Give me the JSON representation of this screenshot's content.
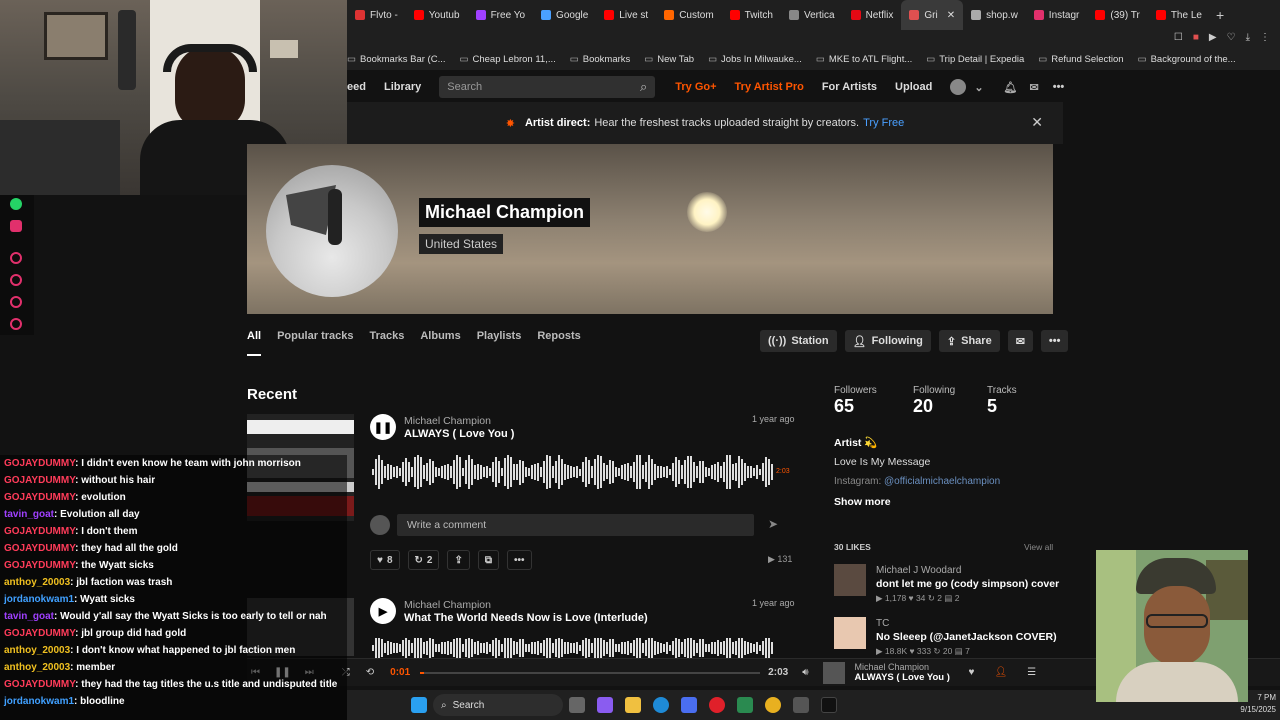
{
  "browser": {
    "tabs": [
      {
        "label": "Flvto -",
        "color": "#d33"
      },
      {
        "label": "Youtub",
        "color": "#f00"
      },
      {
        "label": "Free Yo",
        "color": "#a040ff"
      },
      {
        "label": "Google",
        "color": "#4aa0ff"
      },
      {
        "label": "Live st",
        "color": "#f00"
      },
      {
        "label": "Custom",
        "color": "#f60"
      },
      {
        "label": "Twitch",
        "color": "#f00"
      },
      {
        "label": "Vertica",
        "color": "#888"
      },
      {
        "label": "Netflix",
        "color": "#e50914"
      },
      {
        "label": "Gri",
        "color": "#e05050",
        "active": true
      },
      {
        "label": "shop.w",
        "color": "#aaa"
      },
      {
        "label": "Instagr",
        "color": "#e1306c"
      },
      {
        "label": "(39) Tr",
        "color": "#f00"
      },
      {
        "label": "The Le",
        "color": "#f00"
      }
    ],
    "bookmarks": [
      "Bookmarks Bar (C...",
      "Cheap Lebron 11,...",
      "Bookmarks",
      "New Tab",
      "Jobs In Milwauke...",
      "MKE to ATL Flight...",
      "Trip Detail | Expedia",
      "Refund Selection",
      "Background of the..."
    ]
  },
  "header": {
    "feed": "eed",
    "library": "Library",
    "search_placeholder": "Search",
    "try_go": "Try Go+",
    "try_artist_pro": "Try Artist Pro",
    "for_artists": "For Artists",
    "upload": "Upload"
  },
  "banner": {
    "bold": "Artist direct:",
    "text": "Hear the freshest tracks uploaded straight by creators.",
    "link": "Try Free"
  },
  "profile": {
    "name": "Michael Champion",
    "country": "United States",
    "tabs": [
      "All",
      "Popular tracks",
      "Tracks",
      "Albums",
      "Playlists",
      "Reposts"
    ],
    "buttons": {
      "station": "Station",
      "following": "Following",
      "share": "Share"
    }
  },
  "recent": {
    "heading": "Recent",
    "tracks": [
      {
        "artist": "Michael Champion",
        "title": "ALWAYS ( Love You )",
        "ago": "1 year ago",
        "duration": "2:03",
        "comment_placeholder": "Write a comment",
        "likes": "8",
        "reposts": "2",
        "plays": "131"
      },
      {
        "artist": "Michael Champion",
        "title": "What The World Needs Now is Love (Interlude)",
        "ago": "1 year ago"
      }
    ]
  },
  "stats": {
    "followers_label": "Followers",
    "followers": "65",
    "following_label": "Following",
    "following": "20",
    "tracks_label": "Tracks",
    "tracks": "5"
  },
  "bio": {
    "artist": "Artist 💫",
    "line1": "Love Is My Message",
    "instagram_label": "Instagram:",
    "instagram_handle": "@officialmichaelchampion",
    "show_more": "Show more"
  },
  "likes": {
    "heading": "30 LIKES",
    "view_all": "View all",
    "items": [
      {
        "user": "Michael J Woodard",
        "title": "dont let me go (cody simpson) cover",
        "meta": "▶ 1,178  ♥ 34  ↻ 2  ▤ 2"
      },
      {
        "user": "TC",
        "title": "No Sleeep (@JanetJackson COVER)",
        "meta": "▶ 18.8K  ♥ 333  ↻ 20  ▤ 7"
      }
    ]
  },
  "player": {
    "current": "0:01",
    "total": "2:03",
    "progress": 0.01,
    "artist": "Michael Champion",
    "title": "ALWAYS ( Love You )"
  },
  "chat": [
    {
      "user": "GOJAYDUMMY",
      "cls": "",
      "msg": ": I didn't even know he team with john morrison"
    },
    {
      "user": "GOJAYDUMMY",
      "cls": "",
      "msg": ": without his hair"
    },
    {
      "user": "GOJAYDUMMY",
      "cls": "",
      "msg": ": evolution"
    },
    {
      "user": "tavin_goat",
      "cls": "purple",
      "msg": ": Evolution all day"
    },
    {
      "user": "GOJAYDUMMY",
      "cls": "",
      "msg": ": I don't them"
    },
    {
      "user": "GOJAYDUMMY",
      "cls": "",
      "msg": ": they had all the gold"
    },
    {
      "user": "GOJAYDUMMY",
      "cls": "",
      "msg": ": the Wyatt sicks"
    },
    {
      "user": "anthoy_20003",
      "cls": "yellow",
      "msg": ": jbl faction was trash"
    },
    {
      "user": "jordanokwam1",
      "cls": "blue",
      "msg": ": Wyatt sicks"
    },
    {
      "user": "tavin_goat",
      "cls": "purple",
      "msg": ": Would y'all say the Wyatt Sicks is too early to tell or nah"
    },
    {
      "user": "GOJAYDUMMY",
      "cls": "",
      "msg": ": jbl group did had gold"
    },
    {
      "user": "anthoy_20003",
      "cls": "yellow",
      "msg": ": I don't know what happened to jbl faction men"
    },
    {
      "user": "anthoy_20003",
      "cls": "yellow",
      "msg": ": member"
    },
    {
      "user": "GOJAYDUMMY",
      "cls": "",
      "msg": ": they had the tag titles the u.s title and undisputed title"
    },
    {
      "user": "jordanokwam1",
      "cls": "blue",
      "msg": ": bloodline"
    }
  ],
  "taskbar": {
    "search": "Search",
    "time": "7 PM",
    "date": "9/15/2025"
  }
}
